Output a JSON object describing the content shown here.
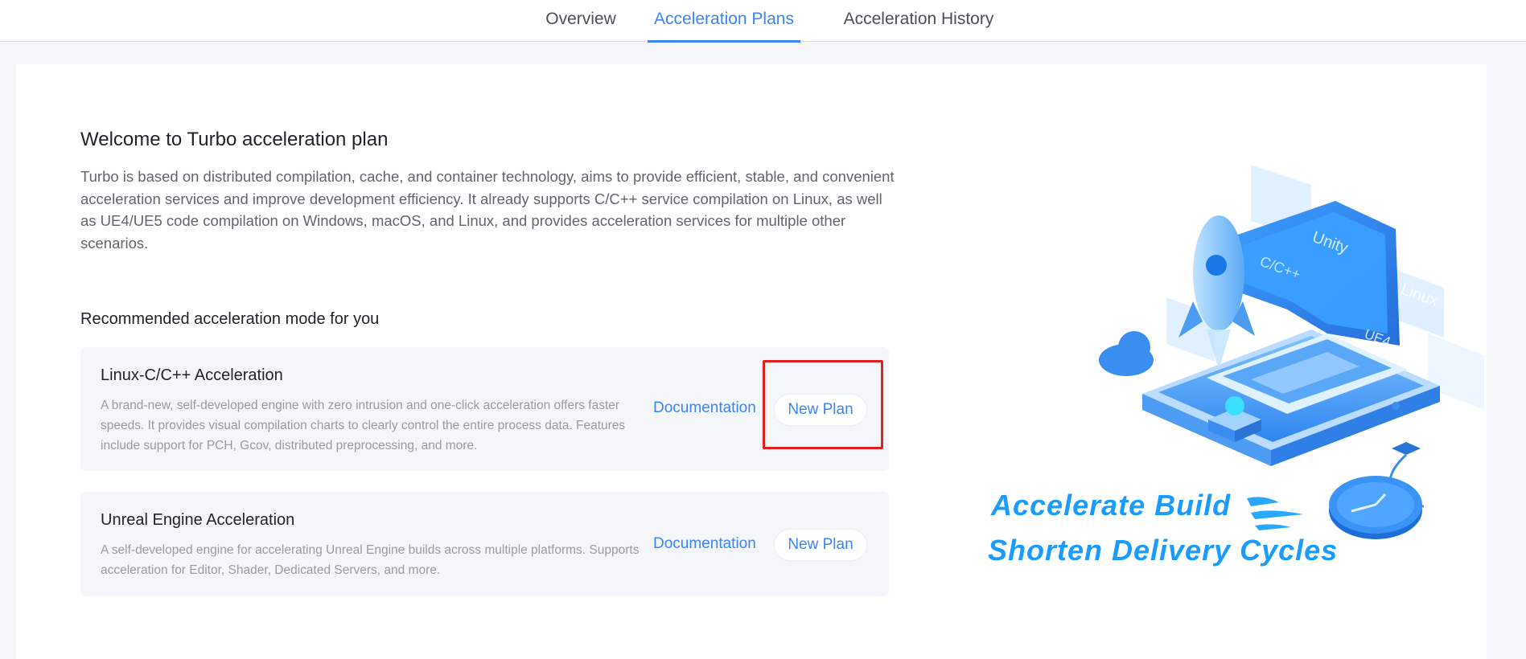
{
  "nav": {
    "tabs": [
      {
        "label": "Overview"
      },
      {
        "label": "Acceleration Plans"
      },
      {
        "label": "Acceleration History"
      }
    ],
    "active_tab": "Acceleration Plans"
  },
  "welcome": {
    "title": "Welcome to Turbo acceleration plan",
    "description": "Turbo is based on distributed compilation, cache, and container technology, aims to provide efficient, stable, and convenient acceleration services and improve development efficiency. It already supports C/C++ service compilation on Linux, as well as UE4/UE5 code compilation on Windows, macOS, and Linux, and provides acceleration services for multiple other scenarios."
  },
  "recommended": {
    "title": "Recommended acceleration mode for you",
    "cards": [
      {
        "title": "Linux-C/C++ Acceleration",
        "description": "A brand-new, self-developed engine with zero intrusion and one-click acceleration offers faster speeds. It provides visual compilation charts to clearly control the entire process data. Features include support for PCH, Gcov, distributed preprocessing, and more.",
        "doc_label": "Documentation",
        "new_plan_label": "New Plan"
      },
      {
        "title": "Unreal Engine Acceleration",
        "description": "A self-developed engine for accelerating Unreal Engine builds across multiple platforms. Supports acceleration for Editor, Shader, Dedicated Servers, and more.",
        "doc_label": "Documentation",
        "new_plan_label": "New Plan"
      }
    ]
  },
  "illustration": {
    "slogan_line1": "Accelerate Build",
    "slogan_line2": "Shorten Delivery Cycles",
    "screen_labels": {
      "cpp": "C/C++",
      "unity": "Unity",
      "linux": "Linux",
      "ue4": "UE4"
    }
  },
  "colors": {
    "accent": "#3a84ff",
    "highlight": "#e02020",
    "slogan": "#1a9bff"
  }
}
